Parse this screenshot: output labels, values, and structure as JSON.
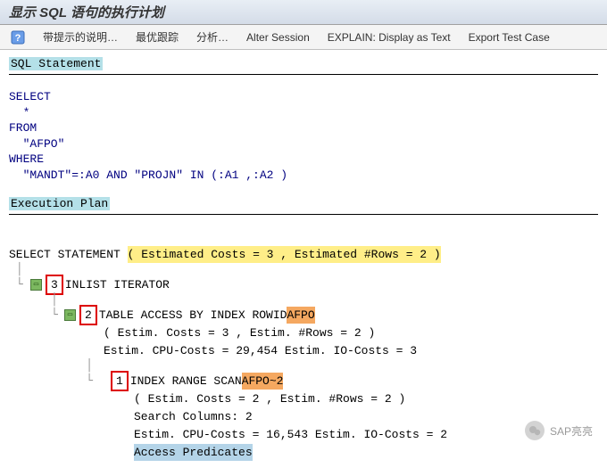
{
  "title": "显示 SQL 语句的执行计划",
  "toolbar": {
    "hint_desc": "带提示的说明…",
    "best_trace": "最优跟踪",
    "analyze": "分析…",
    "alter_session": "Alter Session",
    "explain_text": "EXPLAIN: Display as Text",
    "export_test": "Export Test Case"
  },
  "sections": {
    "sql_statement_header": "SQL Statement",
    "execution_plan_header": "Execution Plan"
  },
  "sql": {
    "line1": "SELECT",
    "line2": "  *",
    "line3": "FROM",
    "line4": "  \"AFPO\"",
    "line5": "WHERE",
    "line6": "  \"MANDT\"=:A0 AND \"PROJN\" IN (:A1 ,:A2 )"
  },
  "plan": {
    "select_stmt_label": "SELECT STATEMENT",
    "select_stmt_costs": "( Estimated Costs = 3 , Estimated #Rows = 2 )",
    "node3_num": "3",
    "node3_label": " INLIST ITERATOR",
    "node2_num": "2",
    "node2_prefix": " TABLE ACCESS BY INDEX ROWID ",
    "node2_table": "AFPO",
    "node2_detail1": "( Estim. Costs = 3 , Estim. #Rows = 2 )",
    "node2_detail2": "Estim. CPU-Costs = 29,454 Estim. IO-Costs = 3",
    "node1_num": "1",
    "node1_prefix": " INDEX RANGE SCAN ",
    "node1_index": "AFPO~2",
    "node1_detail1": "( Estim. Costs = 2 , Estim. #Rows = 2 )",
    "node1_detail2": "Search Columns: 2",
    "node1_detail3": "Estim. CPU-Costs = 16,543 Estim. IO-Costs = 2",
    "node1_detail4": "Access Predicates"
  },
  "watermark": "SAP亮亮"
}
